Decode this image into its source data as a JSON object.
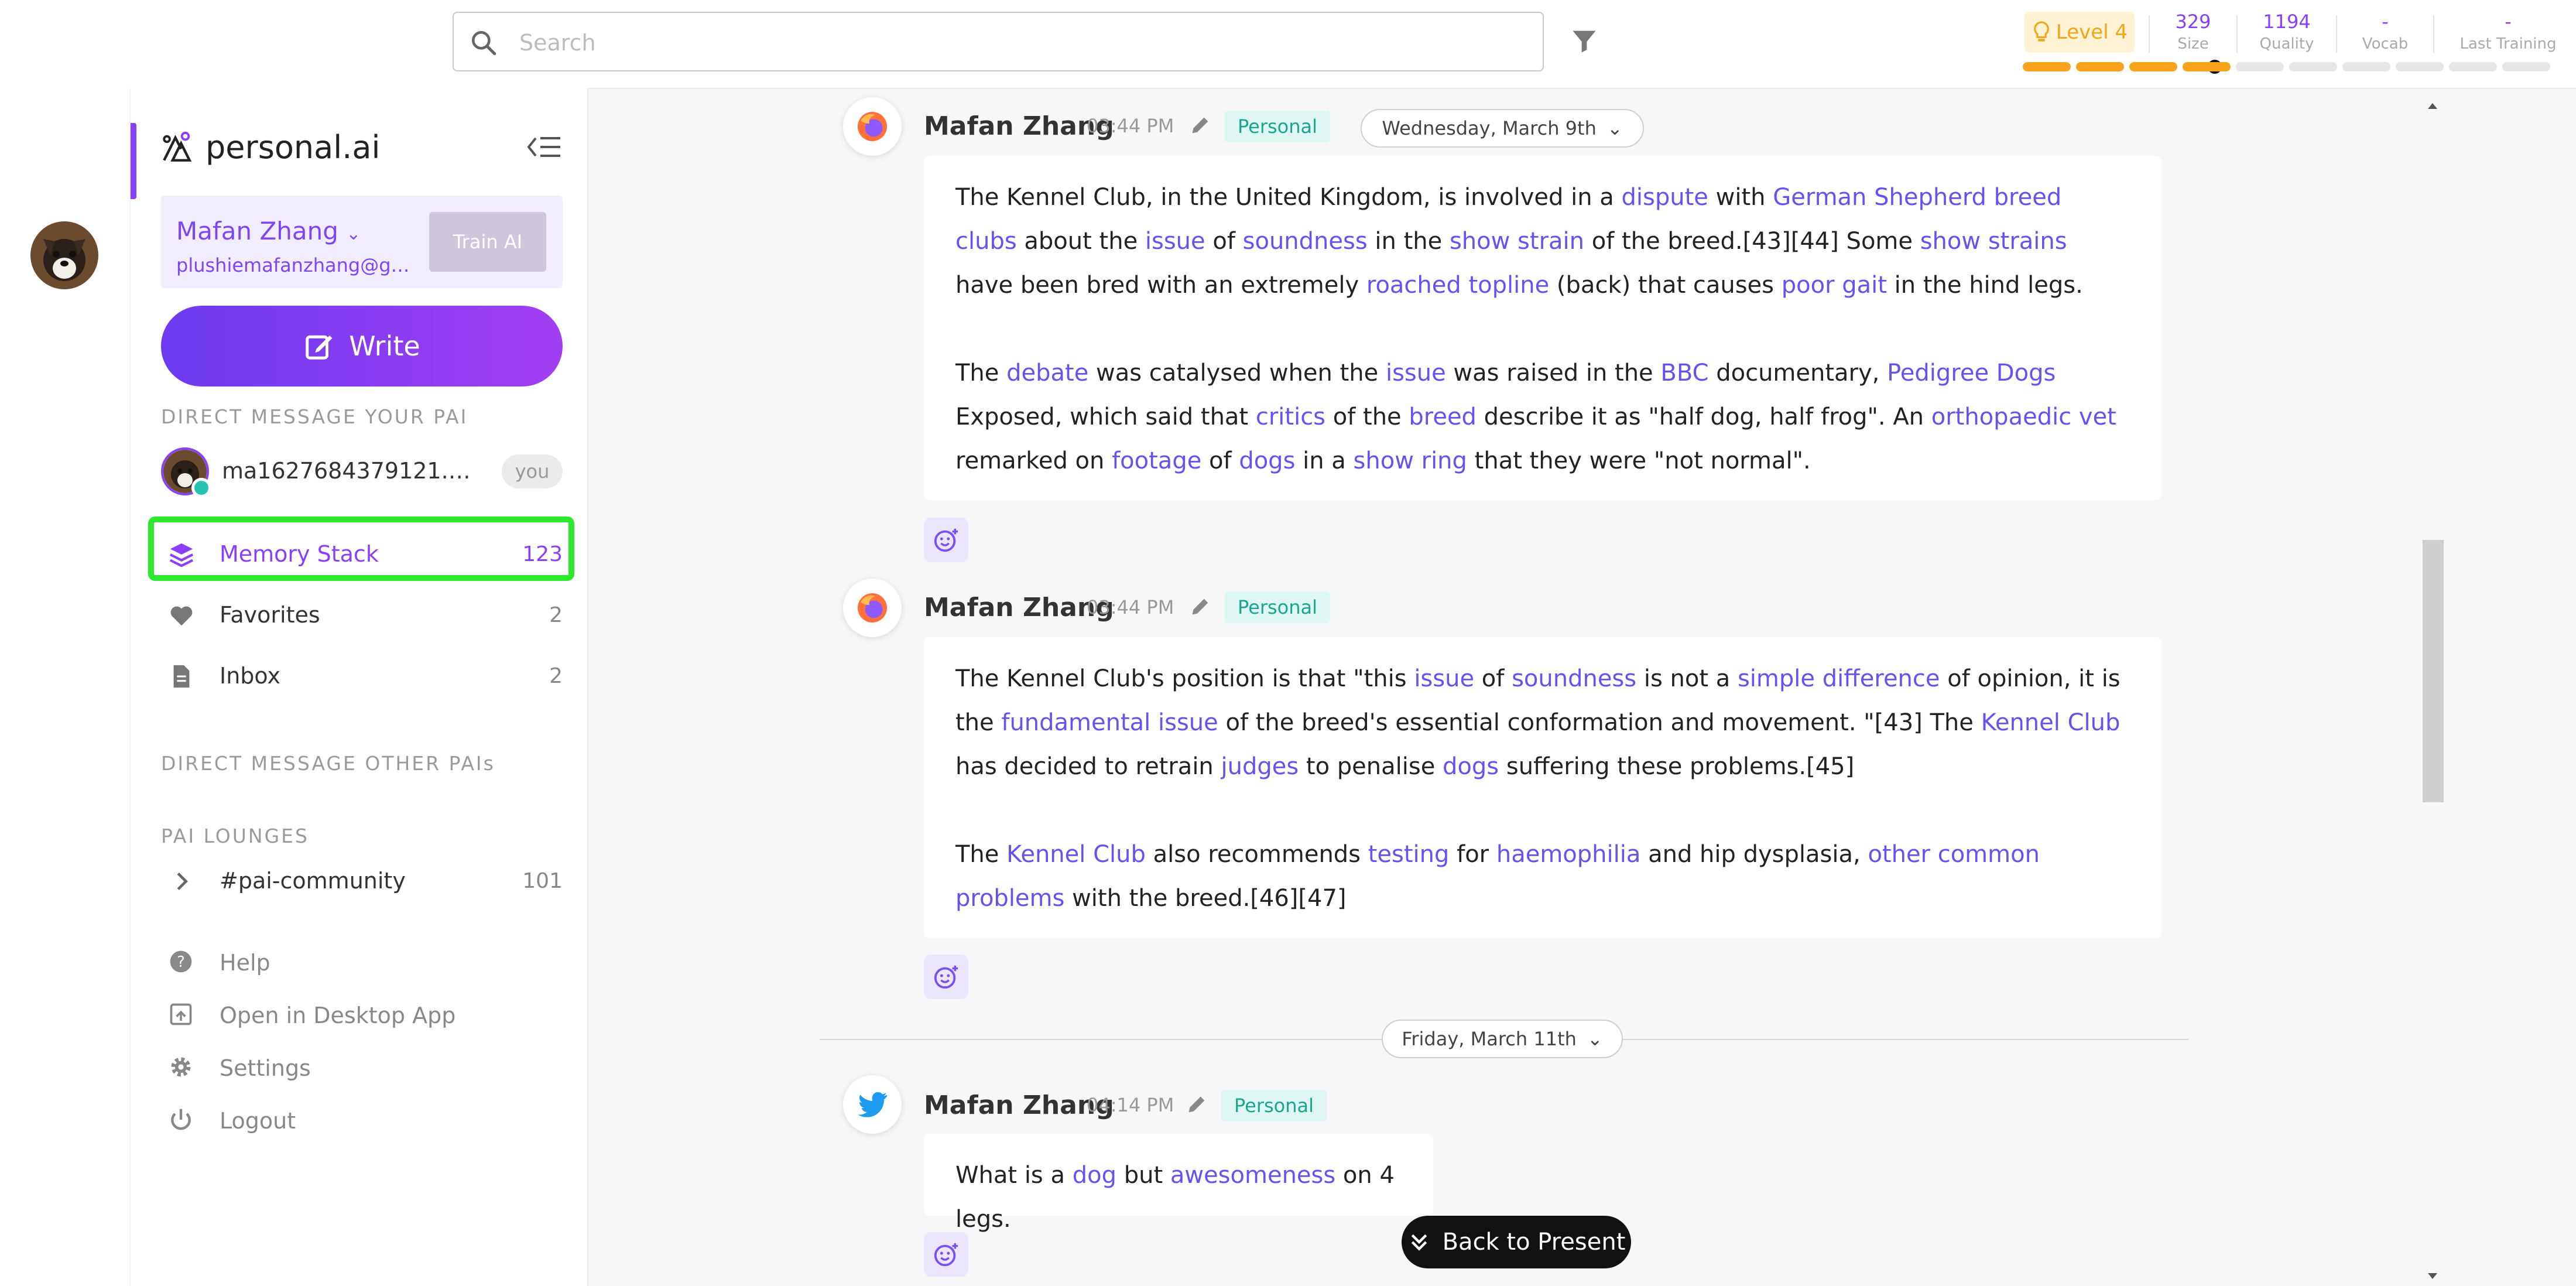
{
  "search": {
    "placeholder": "Search"
  },
  "header": {
    "level": "Level 4",
    "stats": [
      {
        "value": "329",
        "label": "Size"
      },
      {
        "value": "1194",
        "label": "Quality"
      },
      {
        "value": "-",
        "label": "Vocab"
      },
      {
        "value": "-",
        "label": "Last Training"
      }
    ],
    "progress": {
      "filled_segments": 4,
      "total_segments": 10
    }
  },
  "brand": {
    "name": "personal.ai"
  },
  "account": {
    "name": "Mafan Zhang",
    "email": "plushiemafanzhang@gma...",
    "train_label": "Train AI"
  },
  "write_label": "Write",
  "sections": {
    "dm_your_pai": "DIRECT MESSAGE YOUR PAI",
    "dm_other": "DIRECT MESSAGE OTHER PAIs",
    "lounges": "PAI LOUNGES"
  },
  "dm": {
    "name": "ma1627684379121.perso...",
    "badge": "you"
  },
  "nav": [
    {
      "label": "Memory Stack",
      "count": "123"
    },
    {
      "label": "Favorites",
      "count": "2"
    },
    {
      "label": "Inbox",
      "count": "2"
    }
  ],
  "lounge": {
    "label": "#pai-community",
    "count": "101"
  },
  "utility": [
    {
      "label": "Help"
    },
    {
      "label": "Open in Desktop App"
    },
    {
      "label": "Settings"
    },
    {
      "label": "Logout"
    }
  ],
  "messages": [
    {
      "author": "Mafan Zhang",
      "time": "03:44 PM",
      "tag": "Personal",
      "source": "firefox",
      "paragraphs": [
        [
          {
            "t": "The Kennel Club, in the United Kingdom, is involved in a "
          },
          {
            "t": "dispute",
            "link": true
          },
          {
            "t": " with "
          },
          {
            "t": "German Shepherd breed clubs",
            "link": true
          },
          {
            "t": " about the "
          },
          {
            "t": "issue",
            "link": true
          },
          {
            "t": " of "
          },
          {
            "t": "soundness",
            "link": true
          },
          {
            "t": " in the "
          },
          {
            "t": "show strain",
            "link": true
          },
          {
            "t": " of the breed.[43][44] Some "
          },
          {
            "t": "show strains",
            "link": true
          },
          {
            "t": " have been bred with an extremely "
          },
          {
            "t": "roached topline",
            "link": true
          },
          {
            "t": " (back) that causes "
          },
          {
            "t": "poor gait",
            "link": true
          },
          {
            "t": " in the hind legs."
          }
        ],
        [
          {
            "t": " The "
          },
          {
            "t": "debate",
            "link": true
          },
          {
            "t": " was catalysed when the "
          },
          {
            "t": "issue",
            "link": true
          },
          {
            "t": " was raised in the "
          },
          {
            "t": "BBC",
            "link": true
          },
          {
            "t": " documentary, "
          },
          {
            "t": "Pedigree Dogs",
            "link": true
          },
          {
            "t": " Exposed, which said that "
          },
          {
            "t": "critics",
            "link": true
          },
          {
            "t": " of the "
          },
          {
            "t": "breed",
            "link": true
          },
          {
            "t": " describe it as \"half dog, half frog\". An "
          },
          {
            "t": "orthopaedic vet",
            "link": true
          },
          {
            "t": " remarked on "
          },
          {
            "t": "footage",
            "link": true
          },
          {
            "t": " of "
          },
          {
            "t": "dogs",
            "link": true
          },
          {
            "t": " in a "
          },
          {
            "t": "show ring",
            "link": true
          },
          {
            "t": " that they were \"not normal\"."
          }
        ]
      ]
    },
    {
      "author": "Mafan Zhang",
      "time": "03:44 PM",
      "tag": "Personal",
      "source": "firefox",
      "paragraphs": [
        [
          {
            "t": "The Kennel Club's position is that \"this "
          },
          {
            "t": "issue",
            "link": true
          },
          {
            "t": " of "
          },
          {
            "t": "soundness",
            "link": true
          },
          {
            "t": " is not a "
          },
          {
            "t": "simple difference",
            "link": true
          },
          {
            "t": " of opinion, it is the "
          },
          {
            "t": "fundamental issue",
            "link": true
          },
          {
            "t": " of the breed's essential conformation and movement. \"[43] The "
          },
          {
            "t": "Kennel Club",
            "link": true
          },
          {
            "t": " has decided to retrain "
          },
          {
            "t": "judges",
            "link": true
          },
          {
            "t": " to penalise "
          },
          {
            "t": "dogs",
            "link": true
          },
          {
            "t": " suffering these problems.[45]"
          }
        ],
        [
          {
            "t": " The "
          },
          {
            "t": "Kennel Club",
            "link": true
          },
          {
            "t": " also recommends "
          },
          {
            "t": "testing",
            "link": true
          },
          {
            "t": " for "
          },
          {
            "t": "haemophilia",
            "link": true
          },
          {
            "t": " and hip dysplasia, "
          },
          {
            "t": "other common problems",
            "link": true
          },
          {
            "t": " with the breed.[46][47]"
          }
        ]
      ]
    },
    {
      "author": "Mafan Zhang",
      "time": "04:14 PM",
      "tag": "Personal",
      "source": "twitter",
      "paragraphs": [
        [
          {
            "t": "What is a "
          },
          {
            "t": "dog",
            "link": true
          },
          {
            "t": " but "
          },
          {
            "t": "awesomeness",
            "link": true
          },
          {
            "t": " on 4 legs."
          }
        ]
      ]
    }
  ],
  "dates": [
    "Wednesday, March 9th",
    "Friday, March 11th"
  ],
  "back_label": "Back to Present",
  "colors": {
    "accent": "#8a3ffc",
    "link": "#6a4ff2",
    "tag_bg": "#dff7f3",
    "tag_text": "#1aa58e",
    "level": "#f2a516",
    "highlight": "#2ee82e"
  }
}
